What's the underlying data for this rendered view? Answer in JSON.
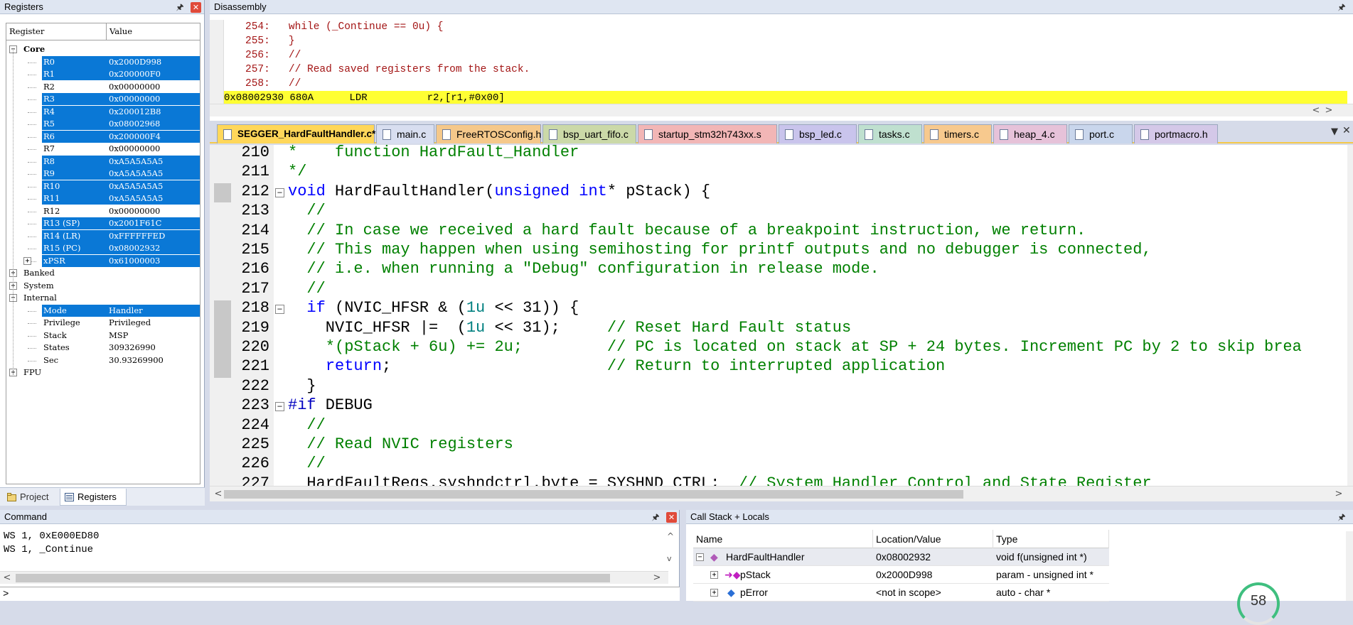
{
  "registers_panel": {
    "title": "Registers",
    "col_register": "Register",
    "col_value": "Value",
    "groups": {
      "core": "Core",
      "banked": "Banked",
      "system": "System",
      "internal": "Internal",
      "fpu": "FPU"
    },
    "core_regs": [
      {
        "name": "R0",
        "value": "0x2000D998",
        "selected": true
      },
      {
        "name": "R1",
        "value": "0x200000F0",
        "selected": true
      },
      {
        "name": "R2",
        "value": "0x00000000",
        "selected": false
      },
      {
        "name": "R3",
        "value": "0x00000000",
        "selected": true
      },
      {
        "name": "R4",
        "value": "0x200012B8",
        "selected": true
      },
      {
        "name": "R5",
        "value": "0x08002968",
        "selected": true
      },
      {
        "name": "R6",
        "value": "0x200000F4",
        "selected": true
      },
      {
        "name": "R7",
        "value": "0x00000000",
        "selected": false
      },
      {
        "name": "R8",
        "value": "0xA5A5A5A5",
        "selected": true
      },
      {
        "name": "R9",
        "value": "0xA5A5A5A5",
        "selected": true
      },
      {
        "name": "R10",
        "value": "0xA5A5A5A5",
        "selected": true
      },
      {
        "name": "R11",
        "value": "0xA5A5A5A5",
        "selected": true
      },
      {
        "name": "R12",
        "value": "0x00000000",
        "selected": false
      },
      {
        "name": "R13 (SP)",
        "value": "0x2001F61C",
        "selected": true
      },
      {
        "name": "R14 (LR)",
        "value": "0xFFFFFFED",
        "selected": true
      },
      {
        "name": "R15 (PC)",
        "value": "0x08002932",
        "selected": true
      },
      {
        "name": "xPSR",
        "value": "0x61000003",
        "selected": true
      }
    ],
    "internal_regs": [
      {
        "name": "Mode",
        "value": "Handler",
        "selected": true
      },
      {
        "name": "Privilege",
        "value": "Privileged",
        "selected": false
      },
      {
        "name": "Stack",
        "value": "MSP",
        "selected": false
      },
      {
        "name": "States",
        "value": "309326990",
        "selected": false
      },
      {
        "name": "Sec",
        "value": "30.93269900",
        "selected": false
      }
    ],
    "tabs": {
      "project": "Project",
      "registers": "Registers"
    }
  },
  "disassembly": {
    "title": "Disassembly",
    "lines": [
      "254:   while (_Continue == 0u) {",
      "255:   }",
      "256:   //",
      "257:   // Read saved registers from the stack.",
      "258:   //"
    ],
    "current": "0x08002930 680A      LDR          r2,[r1,#0x00]"
  },
  "editor_tabs": [
    {
      "label": "SEGGER_HardFaultHandler.c*",
      "color": "#ffd75a"
    },
    {
      "label": "main.c",
      "color": "#d8def0"
    },
    {
      "label": "FreeRTOSConfig.h",
      "color": "#f5c88a"
    },
    {
      "label": "bsp_uart_fifo.c",
      "color": "#cbd9a8"
    },
    {
      "label": "startup_stm32h743xx.s",
      "color": "#f2b6b6"
    },
    {
      "label": "bsp_led.c",
      "color": "#c9c4ec"
    },
    {
      "label": "tasks.c",
      "color": "#bfe0cf"
    },
    {
      "label": "timers.c",
      "color": "#f7c98e"
    },
    {
      "label": "heap_4.c",
      "color": "#e6c2d9"
    },
    {
      "label": "port.c",
      "color": "#c9d6ec"
    },
    {
      "label": "portmacro.h",
      "color": "#d4c8e8"
    }
  ],
  "editor": {
    "lines": [
      {
        "n": "210",
        "t": "*    function HardFault_Handler"
      },
      {
        "n": "211",
        "t": "*/"
      },
      {
        "n": "212",
        "t": "void HardFaultHandler(unsigned int* pStack) {"
      },
      {
        "n": "213",
        "t": "  //"
      },
      {
        "n": "214",
        "t": "  // In case we received a hard fault because of a breakpoint instruction, we return."
      },
      {
        "n": "215",
        "t": "  // This may happen when using semihosting for printf outputs and no debugger is connected,"
      },
      {
        "n": "216",
        "t": "  // i.e. when running a \"Debug\" configuration in release mode."
      },
      {
        "n": "217",
        "t": "  //"
      },
      {
        "n": "218",
        "t": "  if (NVIC_HFSR & (1u << 31)) {"
      },
      {
        "n": "219",
        "t": "    NVIC_HFSR |=  (1u << 31);     // Reset Hard Fault status"
      },
      {
        "n": "220",
        "t": "    *(pStack + 6u) += 2u;         // PC is located on stack at SP + 24 bytes. Increment PC by 2 to skip brea"
      },
      {
        "n": "221",
        "t": "    return;                       // Return to interrupted application"
      },
      {
        "n": "222",
        "t": "  }"
      },
      {
        "n": "223",
        "t": "#if DEBUG"
      },
      {
        "n": "224",
        "t": "  //"
      },
      {
        "n": "225",
        "t": "  // Read NVIC registers"
      },
      {
        "n": "226",
        "t": "  //"
      },
      {
        "n": "227",
        "t": "  HardFaultRegs.syshndctrl.byte = SYSHND_CTRL;  // System Handler Control and State Register"
      }
    ]
  },
  "command": {
    "title": "Command",
    "lines": [
      "WS 1, 0xE000ED80",
      "WS 1, _Continue"
    ],
    "prompt": ">"
  },
  "callstack": {
    "title": "Call Stack + Locals",
    "col_name": "Name",
    "col_location": "Location/Value",
    "col_type": "Type",
    "rows": [
      {
        "name": "HardFaultHandler",
        "value": "0x08002932",
        "type": "void f(unsigned int *)"
      },
      {
        "name": "pStack",
        "value": "0x2000D998",
        "type": "param - unsigned int *"
      },
      {
        "name": "pError",
        "value": "<not in scope>",
        "type": "auto - char *"
      }
    ],
    "gauge_value": "58"
  },
  "colors": {
    "selection": "#0a78d6",
    "current_line": "#ffff33",
    "comment": "#008000",
    "keyword": "#0000ff"
  }
}
